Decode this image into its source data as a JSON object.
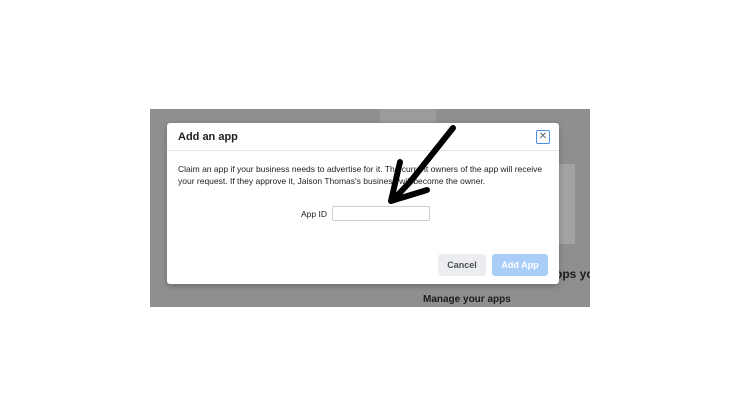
{
  "background": {
    "heading_fragment": "pps yo",
    "manage_label": "Manage your apps"
  },
  "dialog": {
    "title": "Add an app",
    "close_icon": "close-icon",
    "description": "Claim an app if your business needs to advertise for it. The current owners of the app will receive your request. If they approve it, Jaison Thomas's business will become the owner.",
    "app_id_label": "App ID",
    "app_id_value": "",
    "app_id_placeholder": "",
    "cancel_label": "Cancel",
    "add_label": "Add App"
  },
  "annotation": {
    "arrow_icon": "hand-drawn-arrow-icon",
    "arrow_color": "#000000"
  },
  "colors": {
    "overlay": "#8f8f8f",
    "primary_disabled": "#a9cdf6",
    "close_focus": "#4a90e2"
  }
}
